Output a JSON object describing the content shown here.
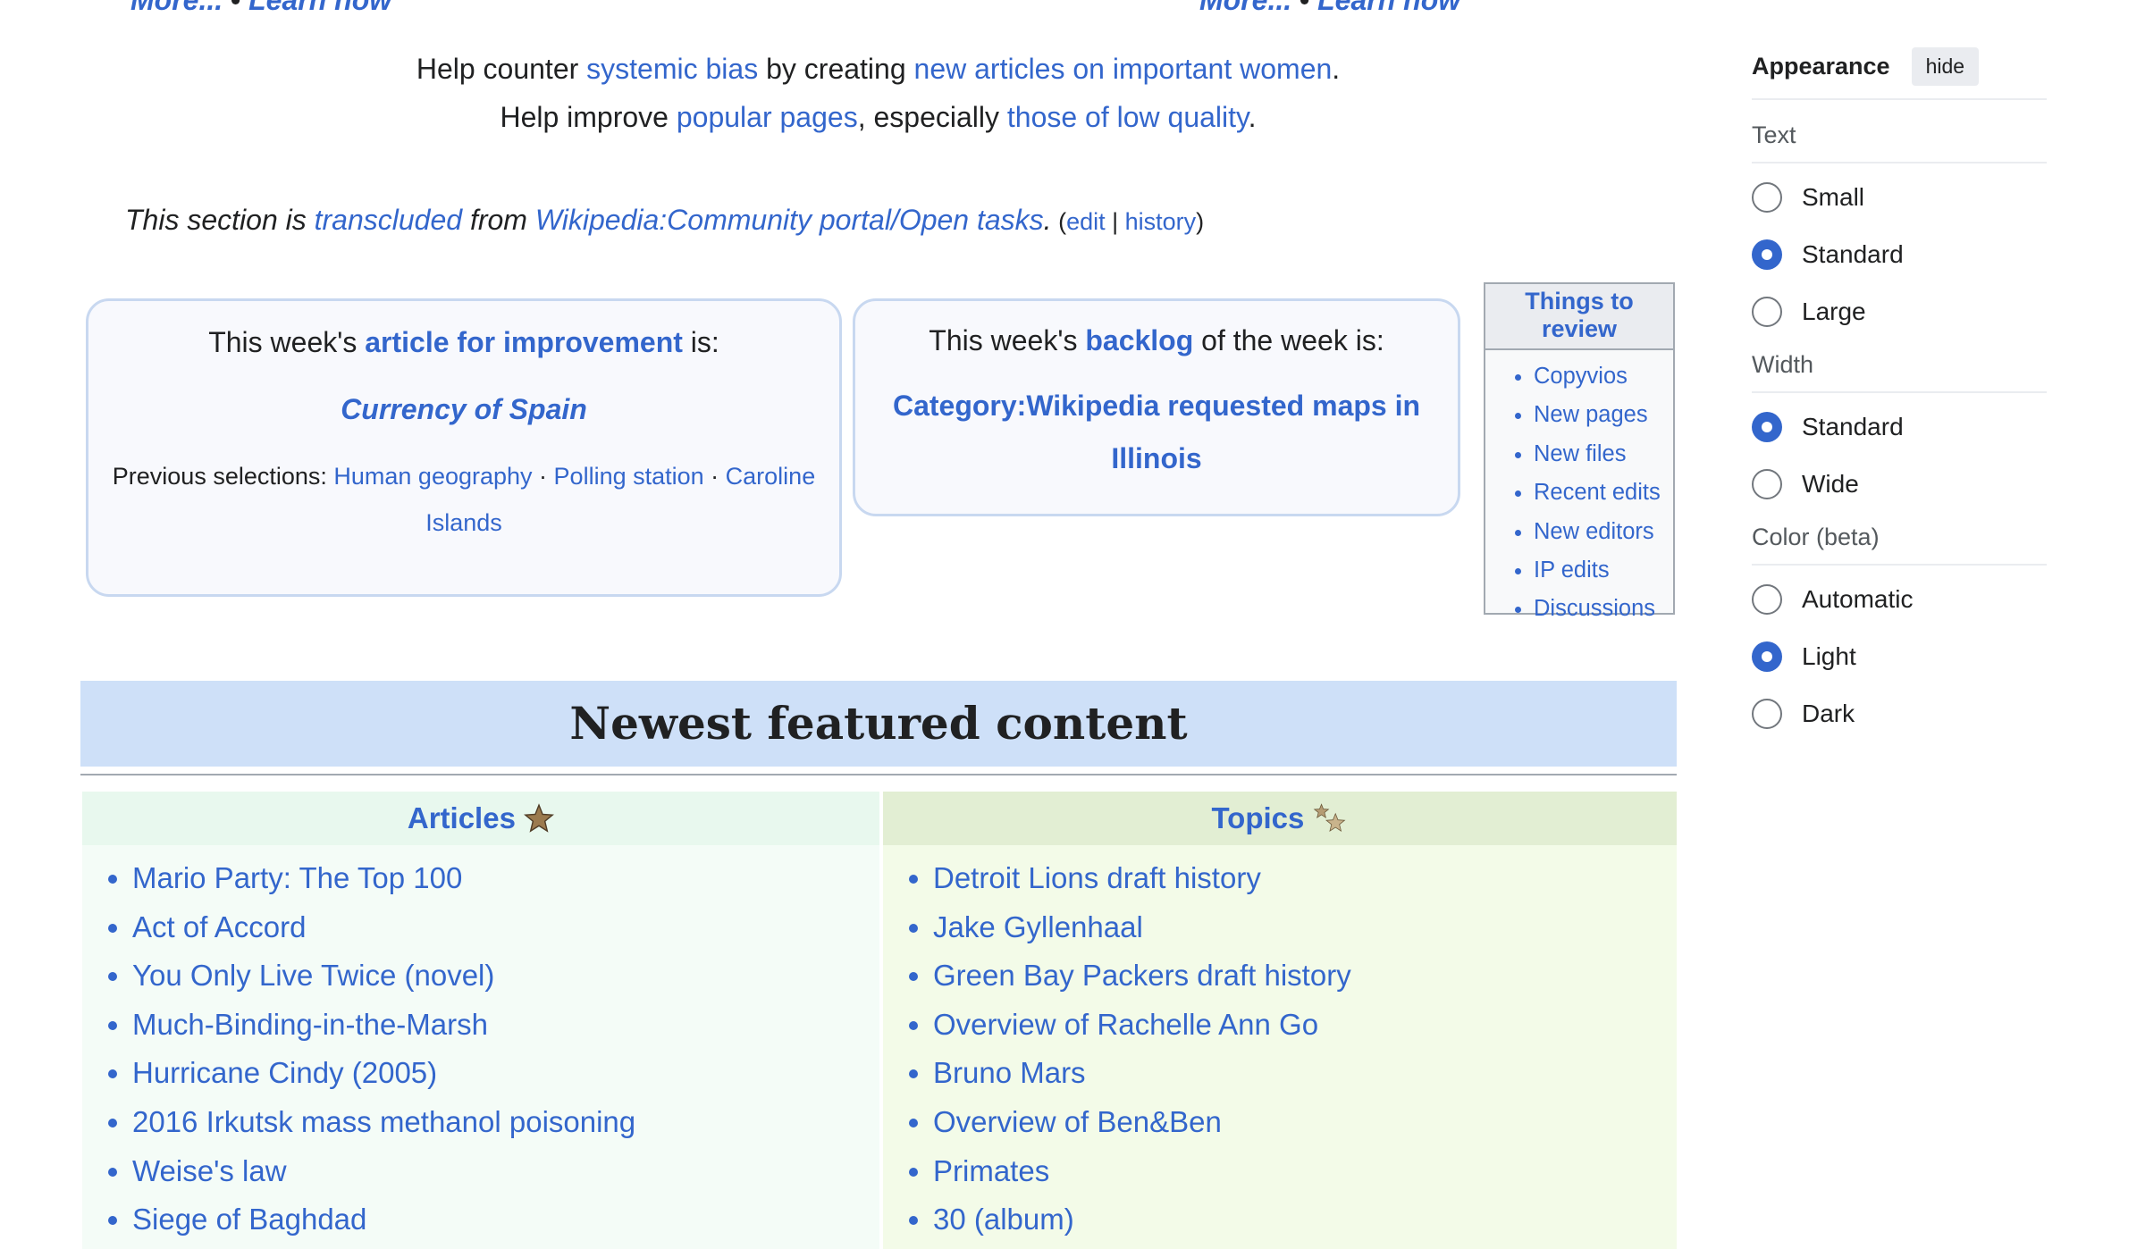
{
  "top_fragments": {
    "left": {
      "more": "More...",
      "sep": "•",
      "learn": "Learn how"
    },
    "right": {
      "more": "More...",
      "sep": "•",
      "learn": "Learn how"
    }
  },
  "help_lines": {
    "line1": {
      "t1": "Help counter ",
      "l1": "systemic bias",
      "t2": " by creating ",
      "l2": "new articles on important women",
      "t3": "."
    },
    "line2": {
      "t1": "Help improve ",
      "l1": "popular pages",
      "t2": ", especially ",
      "l2": "those of low quality",
      "t3": "."
    }
  },
  "transclusion": {
    "t1": "This section is ",
    "l1": "transcluded",
    "t2": " from ",
    "l2": "Wikipedia:Community portal/Open tasks",
    "t3": ".",
    "open": " (",
    "edit": "edit",
    "bar": " | ",
    "history": "history",
    "close": ")"
  },
  "improvement_box": {
    "prefix": "This week's ",
    "link": "article for improvement",
    "suffix": " is:",
    "article": "Currency of Spain",
    "previous_label": "Previous selections: ",
    "previous": [
      "Human geography",
      "Polling station",
      "Caroline Islands"
    ],
    "sep": " · "
  },
  "backlog_box": {
    "prefix": "This week's ",
    "link": "backlog",
    "suffix": " of the week is:",
    "category": "Category:Wikipedia requested maps in Illinois"
  },
  "things_to_review": {
    "title": "Things to review",
    "items": [
      "Copyvios",
      "New pages",
      "New files",
      "Recent edits",
      "New editors",
      "IP edits",
      "Discussions"
    ]
  },
  "newest_featured": {
    "title": "Newest featured content",
    "articles_header": "Articles",
    "topics_header": "Topics",
    "articles": [
      "Mario Party: The Top 100",
      "Act of Accord",
      "You Only Live Twice (novel)",
      "Much-Binding-in-the-Marsh",
      "Hurricane Cindy (2005)",
      "2016 Irkutsk mass methanol poisoning",
      "Weise's law",
      "Siege of Baghdad"
    ],
    "topics": [
      "Detroit Lions draft history",
      "Jake Gyllenhaal",
      "Green Bay Packers draft history",
      "Overview of Rachelle Ann Go",
      "Bruno Mars",
      "Overview of Ben&Ben",
      "Primates",
      "30 (album)"
    ]
  },
  "appearance": {
    "title": "Appearance",
    "hide": "hide",
    "text_label": "Text",
    "text_options": [
      "Small",
      "Standard",
      "Large"
    ],
    "text_selected": "Standard",
    "width_label": "Width",
    "width_options": [
      "Standard",
      "Wide"
    ],
    "width_selected": "Standard",
    "color_label": "Color (beta)",
    "color_options": [
      "Automatic",
      "Light",
      "Dark"
    ],
    "color_selected": "Light"
  },
  "colors": {
    "link": "#3366cc",
    "articles_header_bg": "#e8f8ee",
    "articles_bg": "#f4fcf7",
    "topics_header_bg": "#e2eed3",
    "topics_bg": "#f3fbe8",
    "section_header_bg": "#cee0f8",
    "radio_selected": "#3366cc"
  }
}
